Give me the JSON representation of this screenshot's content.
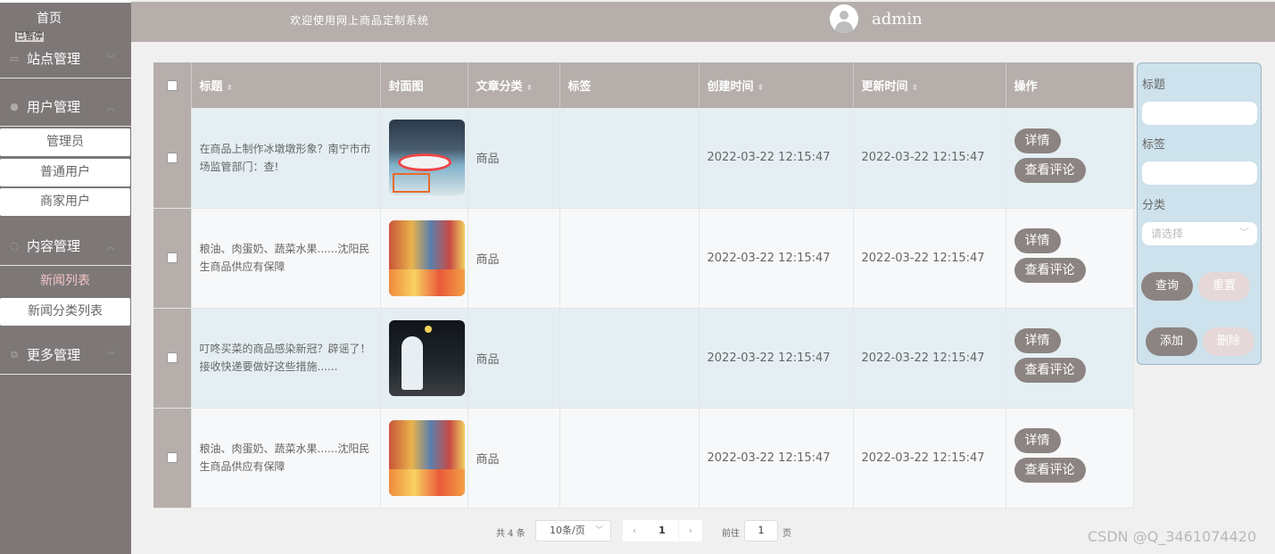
{
  "header": {
    "system_title": "欢迎使用网上商品定制系统",
    "username": "admin"
  },
  "sidebar": {
    "home": "首页",
    "paused": "已暂停",
    "groups": [
      {
        "label": "站点管理",
        "icon": "monitor-icon"
      },
      {
        "label": "用户管理",
        "icon": "user-icon",
        "items": [
          "管理员",
          "普通用户",
          "商家用户"
        ]
      },
      {
        "label": "内容管理",
        "icon": "chat-icon",
        "items": [
          "新闻列表",
          "新闻分类列表"
        ],
        "active": "新闻列表"
      },
      {
        "label": "更多管理",
        "icon": "copy-icon"
      }
    ]
  },
  "table": {
    "columns": [
      "标题",
      "封面图",
      "文章分类",
      "标签",
      "创建时间",
      "更新时间",
      "操作"
    ],
    "rows": [
      {
        "title": "在商品上制作冰墩墩形象？南宁市市场监管部门：查!",
        "category": "商品",
        "tag": "",
        "created": "2022-03-22 12:15:47",
        "updated": "2022-03-22 12:15:47"
      },
      {
        "title": "粮油、肉蛋奶、蔬菜水果......沈阳民生商品供应有保障",
        "category": "商品",
        "tag": "",
        "created": "2022-03-22 12:15:47",
        "updated": "2022-03-22 12:15:47"
      },
      {
        "title": "叮咚买菜的商品感染新冠？辟谣了！接收快递要做好这些措施......",
        "category": "商品",
        "tag": "",
        "created": "2022-03-22 12:15:47",
        "updated": "2022-03-22 12:15:47"
      },
      {
        "title": "粮油、肉蛋奶、蔬菜水果......沈阳民生商品供应有保障",
        "category": "商品",
        "tag": "",
        "created": "2022-03-22 12:15:47",
        "updated": "2022-03-22 12:15:47"
      }
    ],
    "actions": {
      "detail": "详情",
      "comments": "查看评论"
    }
  },
  "search": {
    "title_label": "标题",
    "tag_label": "标签",
    "category_label": "分类",
    "category_placeholder": "请选择",
    "query": "查询",
    "reset": "重置",
    "add": "添加",
    "delete": "删除"
  },
  "pagination": {
    "total": "共 4 条",
    "page_size": "10条/页",
    "current": "1",
    "goto_label": "前往",
    "goto_value": "1",
    "page_unit": "页"
  },
  "watermark": "CSDN @Q_3461074420"
}
